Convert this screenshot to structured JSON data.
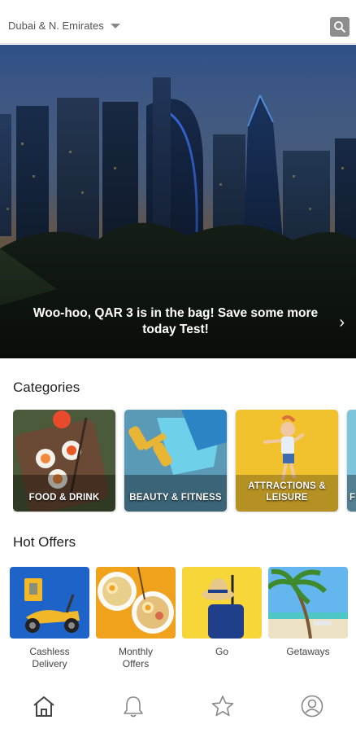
{
  "header": {
    "location": "Dubai & N. Emirates",
    "search_icon": "search-icon"
  },
  "hero": {
    "message": "Woo-hoo, QAR 3 is in the bag!  Save some more today Test!",
    "chevron_icon": "chevron-right-icon"
  },
  "categories": {
    "title": "Categories",
    "items": [
      {
        "label": "FOOD & DRINK"
      },
      {
        "label": "BEAUTY & FITNESS"
      },
      {
        "label": "ATTRACTIONS & LEISURE"
      },
      {
        "label": "F"
      }
    ]
  },
  "hot_offers": {
    "title": "Hot Offers",
    "items": [
      {
        "label": "Cashless Delivery"
      },
      {
        "label": "Monthly Offers"
      },
      {
        "label": "Go"
      },
      {
        "label": "Getaways"
      }
    ]
  },
  "bottom_nav": {
    "items": [
      "home-icon",
      "bell-icon",
      "star-icon",
      "profile-icon"
    ]
  }
}
